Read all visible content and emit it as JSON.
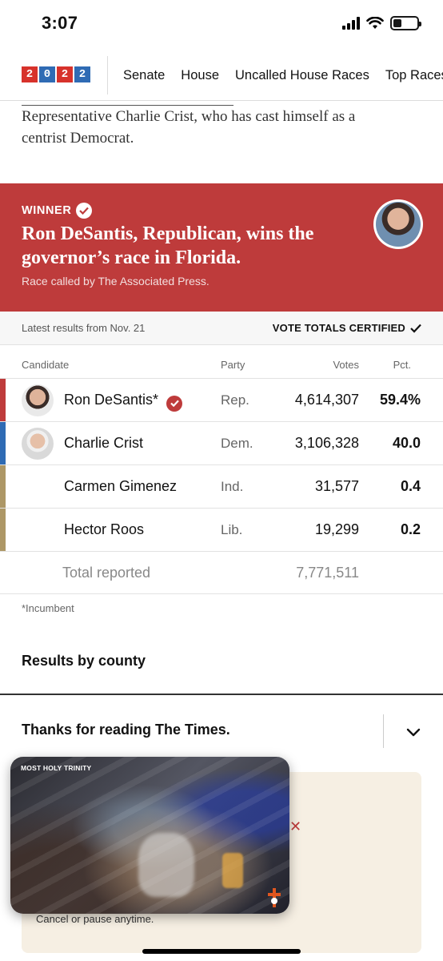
{
  "status_bar": {
    "time": "3:07"
  },
  "nav": {
    "logo_digits": [
      "2",
      "0",
      "2",
      "2"
    ],
    "logo_colors": [
      "#d7322b",
      "#2f6bb4",
      "#d7322b",
      "#2f6bb4"
    ],
    "items": [
      "Senate",
      "House",
      "Uncalled House Races",
      "Top Races"
    ]
  },
  "article": {
    "lines": [
      "Representative Charlie Crist, who has cast himself as a",
      "centrist Democrat."
    ]
  },
  "winner": {
    "label": "WINNER",
    "headline": "Ron DeSantis, Republican, wins the governor’s race in Florida.",
    "called_by": "Race called by The Associated Press.",
    "color": "#be3b3b"
  },
  "results": {
    "latest": "Latest results from Nov. 21",
    "certified": "VOTE TOTALS CERTIFIED",
    "headers": {
      "candidate": "Candidate",
      "party": "Party",
      "votes": "Votes",
      "pct": "Pct."
    },
    "rows": [
      {
        "name": "Ron DeSantis*",
        "party": "Rep.",
        "votes": "4,614,307",
        "pct": "59.4%",
        "bar_color": "#be3b3b",
        "winner": true
      },
      {
        "name": "Charlie Crist",
        "party": "Dem.",
        "votes": "3,106,328",
        "pct": "40.0",
        "bar_color": "#2f6bb4",
        "winner": false
      },
      {
        "name": "Carmen Gimenez",
        "party": "Ind.",
        "votes": "31,577",
        "pct": "0.4",
        "bar_color": "#ad9766",
        "winner": false
      },
      {
        "name": "Hector Roos",
        "party": "Lib.",
        "votes": "19,299",
        "pct": "0.2",
        "bar_color": "#ad9766",
        "winner": false
      }
    ],
    "total_label": "Total reported",
    "total_votes": "7,771,511",
    "incumbent_note": "*Incumbent"
  },
  "county_section": {
    "title": "Results by county"
  },
  "bottom_sheet": {
    "title": "Thanks for reading The Times.",
    "cancel_text": "Cancel or pause anytime."
  },
  "video": {
    "title": "MOST HOLY TRINITY"
  }
}
